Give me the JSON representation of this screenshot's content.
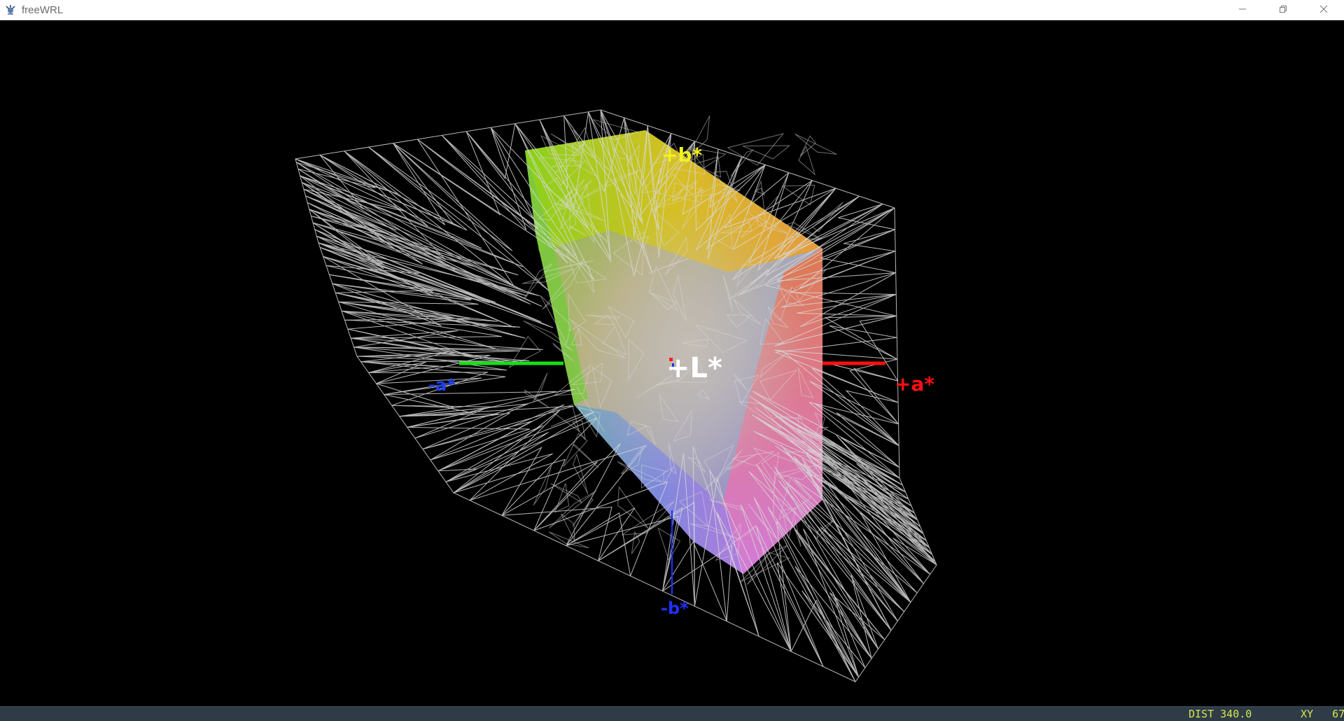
{
  "window": {
    "title": "freeWRL",
    "app_icon": "freewrl-logo-icon",
    "controls": {
      "minimize_icon": "minimize-icon",
      "restore_icon": "restore-icon",
      "close_icon": "close-icon"
    }
  },
  "scene": {
    "background_color": "#000000",
    "axes": {
      "plus_L": {
        "label": "+L*",
        "color": "#ffffff"
      },
      "plus_a": {
        "label": "+a*",
        "color": "#ff1010"
      },
      "minus_a": {
        "label": "-a*",
        "color": "#2040ff"
      },
      "plus_b": {
        "label": "+b*",
        "color": "#f2f21a"
      },
      "minus_b": {
        "label": "-b*",
        "color": "#2030ff"
      },
      "minus_a_line_color": "#18e018",
      "minus_b_line_color": "#2030ff"
    },
    "wireframe_color": "#d8d8d8"
  },
  "status": {
    "dist_label": "DIST",
    "dist_value": "340.0",
    "nav_mode": "XY",
    "nav_value": "67"
  }
}
